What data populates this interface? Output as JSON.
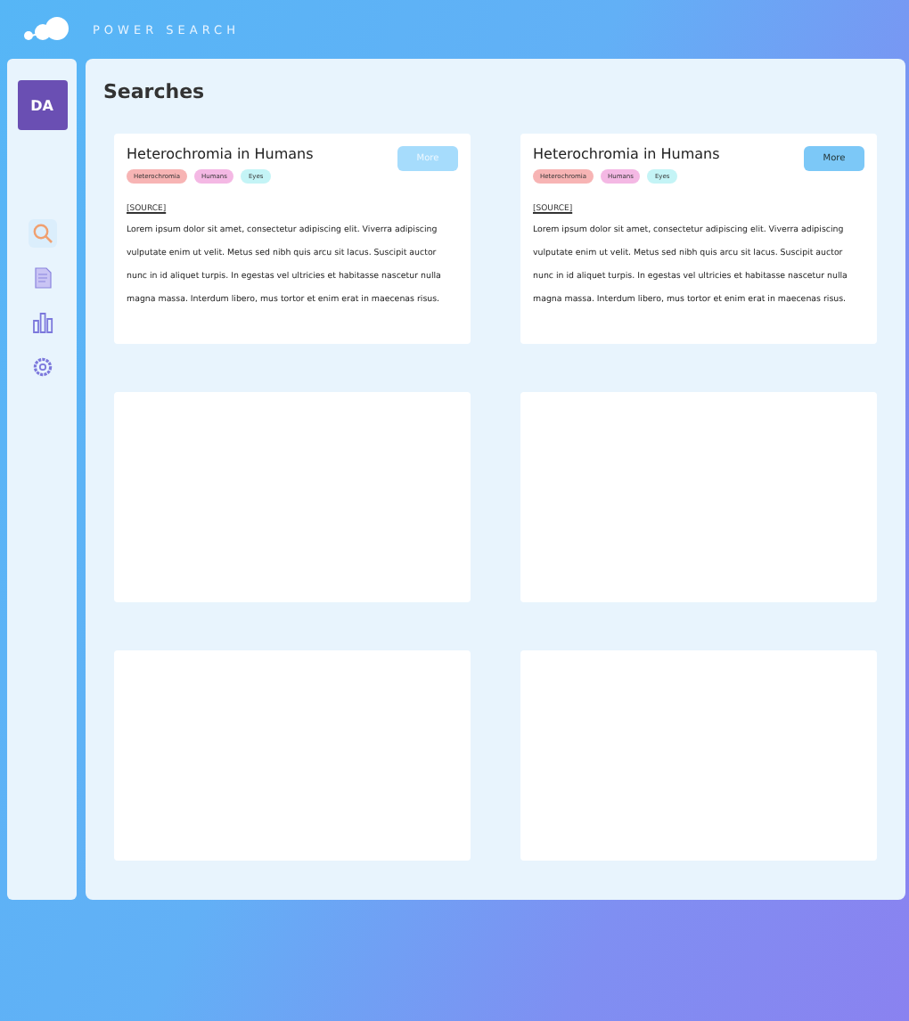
{
  "app": {
    "name": "POWER SEARCH"
  },
  "sidebar": {
    "avatar": "DA",
    "items": [
      {
        "kind": "search",
        "selected": true
      },
      {
        "kind": "document",
        "selected": false
      },
      {
        "kind": "chart",
        "selected": false
      },
      {
        "kind": "settings",
        "selected": false
      }
    ]
  },
  "page": {
    "title": "Searches"
  },
  "cards": [
    {
      "kind": "result",
      "title": "Heterochromia in Humans",
      "tags": [
        {
          "label": "Heterochromia",
          "color": "#f7b4b4"
        },
        {
          "label": "Humans",
          "color": "#f4b8e4"
        },
        {
          "label": "Eyes",
          "color": "#c4f4f6"
        }
      ],
      "button": {
        "label": "More",
        "disabled": true
      },
      "source": "[SOURCE]",
      "body": "Lorem ipsum dolor sit amet, consectetur adipiscing elit. Viverra adipiscing vulputate enim ut velit. Metus sed nibh quis arcu sit lacus. Suscipit auctor nunc in id aliquet turpis. In egestas vel ultricies et habitasse nascetur nulla magna massa. Interdum libero, mus tortor et enim erat in maecenas risus."
    },
    {
      "kind": "result",
      "title": "Heterochromia in Humans",
      "tags": [
        {
          "label": "Heterochromia",
          "color": "#f7b4b4"
        },
        {
          "label": "Humans",
          "color": "#f4b8e4"
        },
        {
          "label": "Eyes",
          "color": "#c4f4f6"
        }
      ],
      "button": {
        "label": "More",
        "disabled": false
      },
      "source": "[SOURCE]",
      "body": "Lorem ipsum dolor sit amet, consectetur adipiscing elit. Viverra adipiscing vulputate enim ut velit. Metus sed nibh quis arcu sit lacus. Suscipit auctor nunc in id aliquet turpis. In egestas vel ultricies et habitasse nascetur nulla magna massa. Interdum libero, mus tortor et enim erat in maecenas risus."
    },
    {
      "kind": "empty"
    },
    {
      "kind": "empty"
    },
    {
      "kind": "empty"
    },
    {
      "kind": "empty"
    }
  ]
}
